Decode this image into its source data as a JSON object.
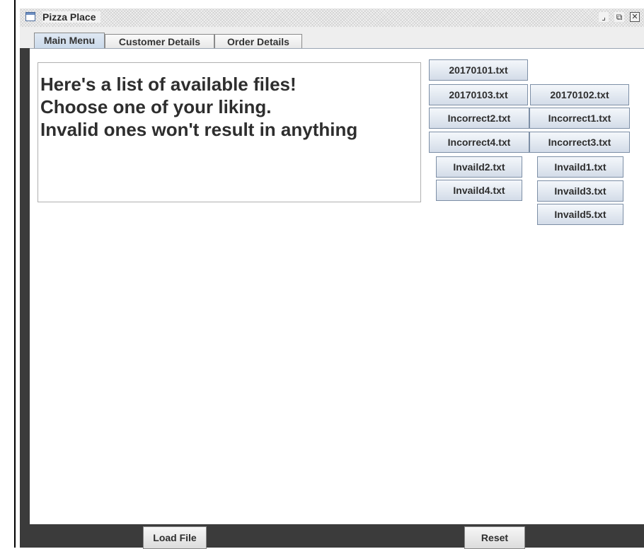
{
  "window": {
    "title": "Pizza Place",
    "controls": {
      "restore": "⌟",
      "maximize": "⧉",
      "close": "✕"
    }
  },
  "tabs": [
    {
      "label": "Main Menu",
      "active": true
    },
    {
      "label": "Customer Details",
      "active": false
    },
    {
      "label": "Order Details",
      "active": false
    }
  ],
  "message": {
    "lines": [
      "Here's a list of available files!",
      "Choose one of your liking.",
      "Invalid ones won't result in anything"
    ]
  },
  "files": {
    "f20170101": "20170101.txt",
    "f20170103": "20170103.txt",
    "f20170102": "20170102.txt",
    "incorrect2": "Incorrect2.txt",
    "incorrect1": "Incorrect1.txt",
    "incorrect4": "Incorrect4.txt",
    "incorrect3": "Incorrect3.txt",
    "invaild2": "Invaild2.txt",
    "invaild1": "Invaild1.txt",
    "invaild4": "Invaild4.txt",
    "invaild3": "Invaild3.txt",
    "invaild5": "Invaild5.txt"
  },
  "bottom": {
    "load_label": "Load File",
    "reset_label": "Reset"
  }
}
